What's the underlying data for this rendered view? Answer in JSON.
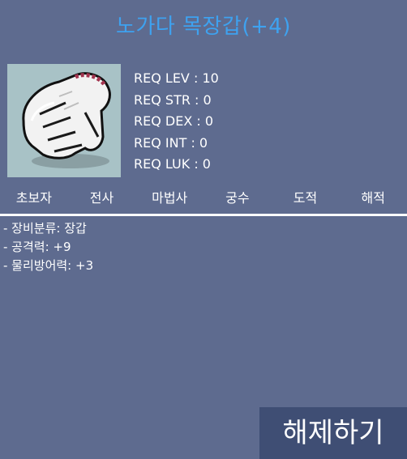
{
  "item": {
    "name": "노가다 목장갑(+4)",
    "icon": "white-cotton-glove-icon",
    "name_color": "#3ea2f0"
  },
  "requirements": [
    "REQ LEV : 10",
    "REQ STR : 0",
    "REQ DEX : 0",
    "REQ INT : 0",
    "REQ LUK : 0"
  ],
  "jobs": [
    "초보자",
    "전사",
    "마법사",
    "궁수",
    "도적",
    "해적"
  ],
  "stats": [
    "- 장비분류: 장갑",
    "- 공격력: +9",
    "- 물리방어력: +3"
  ],
  "actions": {
    "release_label": "해제하기"
  },
  "colors": {
    "background": "#5e6b8f",
    "button": "#3f4e74"
  }
}
